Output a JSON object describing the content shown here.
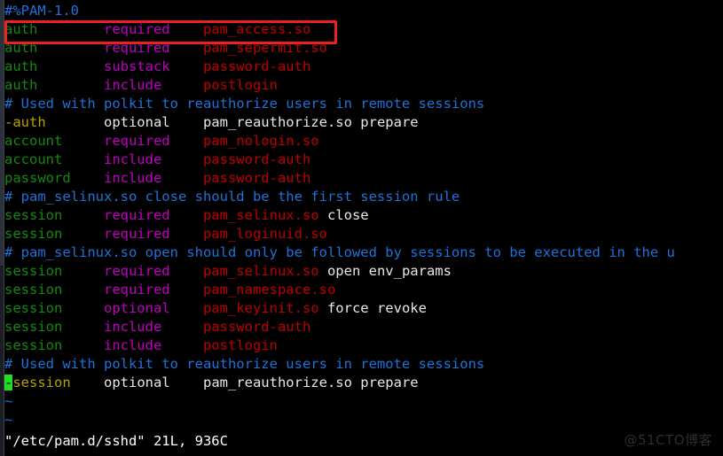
{
  "editor": {
    "app": "vim",
    "filename": "/etc/pam.d/sshd",
    "status_text": "\"/etc/pam.d/sshd\" 21L, 936C",
    "line_count": "21L",
    "byte_count": "936C",
    "cursor_char": "-",
    "empty_line_marker": "~"
  },
  "colors": {
    "background": "#000000",
    "comment": "#1e72d8",
    "type": "#128a12",
    "control": "#c000c0",
    "module": "#be0000",
    "argument": "#e8e8e8",
    "dash_line": "#b8a000",
    "cursor": "#22dd22",
    "annotation": "#ee2020",
    "status": "#ffffff",
    "watermark": "#2e2e2e"
  },
  "annotation": {
    "label": "highlight-box-auth-pam-access",
    "target_line_index": 1
  },
  "watermark": {
    "text": "@51CTO博客"
  },
  "lines": [
    {
      "kind": "comment",
      "text": "#%PAM-1.0"
    },
    {
      "kind": "rule",
      "type": "auth",
      "control": "required",
      "module": "pam_access.so",
      "args": ""
    },
    {
      "kind": "rule",
      "type": "auth",
      "control": "required",
      "module": "pam_sepermit.so",
      "args": ""
    },
    {
      "kind": "rule",
      "type": "auth",
      "control": "substack",
      "module": "password-auth",
      "args": ""
    },
    {
      "kind": "rule",
      "type": "auth",
      "control": "include",
      "module": "postlogin",
      "args": ""
    },
    {
      "kind": "comment",
      "text": "# Used with polkit to reauthorize users in remote sessions"
    },
    {
      "kind": "dash",
      "type": "-auth",
      "control": "optional",
      "module": "pam_reauthorize.so",
      "args": "prepare"
    },
    {
      "kind": "rule",
      "type": "account",
      "control": "required",
      "module": "pam_nologin.so",
      "args": ""
    },
    {
      "kind": "rule",
      "type": "account",
      "control": "include",
      "module": "password-auth",
      "args": ""
    },
    {
      "kind": "rule",
      "type": "password",
      "control": "include",
      "module": "password-auth",
      "args": ""
    },
    {
      "kind": "comment",
      "text": "# pam_selinux.so close should be the first session rule"
    },
    {
      "kind": "rule",
      "type": "session",
      "control": "required",
      "module": "pam_selinux.so",
      "args": "close"
    },
    {
      "kind": "rule",
      "type": "session",
      "control": "required",
      "module": "pam_loginuid.so",
      "args": ""
    },
    {
      "kind": "comment",
      "text": "# pam_selinux.so open should only be followed by sessions to be executed in the u"
    },
    {
      "kind": "rule",
      "type": "session",
      "control": "required",
      "module": "pam_selinux.so",
      "args": "open env_params"
    },
    {
      "kind": "rule",
      "type": "session",
      "control": "required",
      "module": "pam_namespace.so",
      "args": ""
    },
    {
      "kind": "rule",
      "type": "session",
      "control": "optional",
      "module": "pam_keyinit.so",
      "args": "force revoke"
    },
    {
      "kind": "rule",
      "type": "session",
      "control": "include",
      "module": "password-auth",
      "args": ""
    },
    {
      "kind": "rule",
      "type": "session",
      "control": "include",
      "module": "postlogin",
      "args": ""
    },
    {
      "kind": "comment",
      "text": "# Used with polkit to reauthorize users in remote sessions"
    },
    {
      "kind": "dash-cursor",
      "type": "-session",
      "control": "optional",
      "module": "pam_reauthorize.so",
      "args": "prepare"
    },
    {
      "kind": "empty",
      "text": "~"
    },
    {
      "kind": "empty",
      "text": "~"
    }
  ]
}
